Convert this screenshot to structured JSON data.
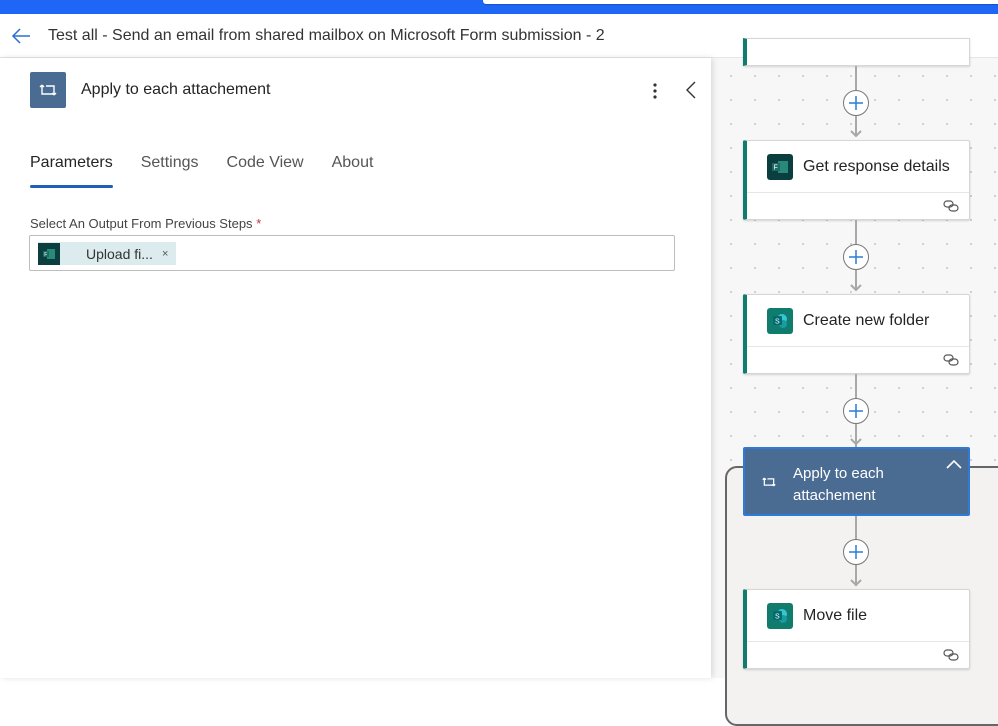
{
  "header": {
    "back_icon": "arrow-left-icon",
    "title": "Test all - Send an email from shared mailbox on Microsoft Form submission - 2"
  },
  "panel": {
    "icon": "loop-icon",
    "title": "Apply to each attachement",
    "more_icon": "more-vertical-icon",
    "collapse_icon": "chevron-left-icon",
    "tabs": [
      {
        "label": "Parameters",
        "active": true
      },
      {
        "label": "Settings",
        "active": false
      },
      {
        "label": "Code View",
        "active": false
      },
      {
        "label": "About",
        "active": false
      }
    ],
    "field": {
      "label": "Select An Output From Previous Steps",
      "required_mark": "*",
      "chip": {
        "icon": "microsoft-forms-icon",
        "label": "Upload fi...",
        "remove": "×"
      }
    }
  },
  "canvas": {
    "cards": [
      {
        "title": "Get response details",
        "icon": "microsoft-forms-icon"
      },
      {
        "title": "Create new folder",
        "icon": "sharepoint-icon"
      },
      {
        "title": "Move file",
        "icon": "sharepoint-icon"
      }
    ],
    "loop": {
      "title": "Apply to each attachement",
      "icon": "loop-icon",
      "toggle_icon": "chevron-up-icon"
    }
  },
  "colors": {
    "accent": "#1e66f5",
    "loop_header": "#4a6b92",
    "card_border": "#0f7c6e",
    "tab_underline": "#1f5fb8",
    "required": "#c4314b"
  }
}
